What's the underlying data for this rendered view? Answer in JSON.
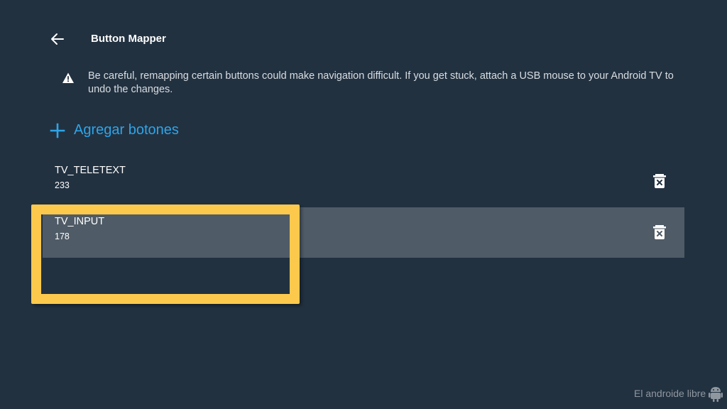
{
  "header": {
    "title": "Button Mapper",
    "back_icon": "arrow-left-icon"
  },
  "warning": {
    "icon": "warning-icon",
    "text": "Be careful, remapping certain buttons could make navigation difficult. If you get stuck, attach a USB mouse to your Android TV to undo the changes."
  },
  "add_button": {
    "label": "Agregar botones",
    "icon": "plus-icon"
  },
  "mapped_buttons": [
    {
      "name": "TV_TELETEXT",
      "code": "233",
      "selected": false,
      "delete_icon": "delete-icon"
    },
    {
      "name": "TV_INPUT",
      "code": "178",
      "selected": true,
      "delete_icon": "delete-icon"
    }
  ],
  "watermark": {
    "text": "El androide libre"
  },
  "colors": {
    "background": "#223140",
    "accent": "#2ea5e9",
    "selected_row": "#4f5b66",
    "highlight_box": "#fdc94c"
  }
}
